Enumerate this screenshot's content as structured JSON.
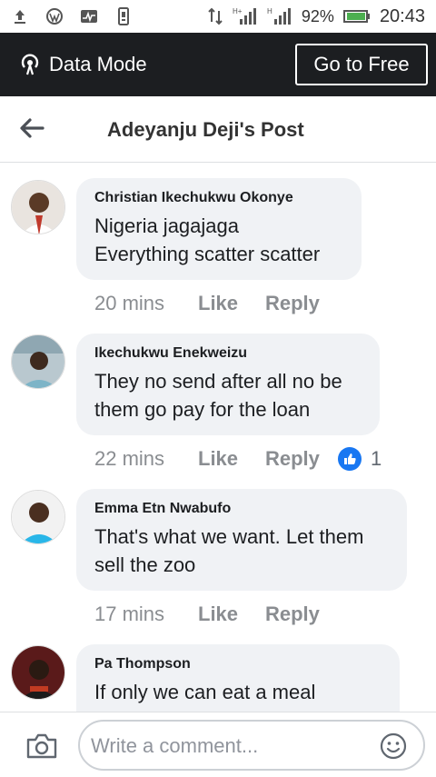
{
  "status_bar": {
    "battery": "92%",
    "time": "20:43",
    "icons": [
      "upload-icon",
      "wordpress-icon",
      "activity-icon",
      "phone-icon",
      "data-arrows-icon",
      "signal-h-icon",
      "signal-h-icon",
      "battery-icon"
    ]
  },
  "data_mode": {
    "label": "Data Mode",
    "button": "Go to Free"
  },
  "header": {
    "title": "Adeyanju Deji's Post"
  },
  "comments": [
    {
      "name": "Christian Ikechukwu Okonye",
      "lines": [
        "Nigeria jagajaga",
        "Everything scatter scatter"
      ],
      "time": "20 mins",
      "like": "Like",
      "reply": "Reply",
      "reactions": ""
    },
    {
      "name": "Ikechukwu Enekweizu",
      "lines": [
        "They no send after all no be",
        "them go pay for the loan"
      ],
      "time": "22 mins",
      "like": "Like",
      "reply": "Reply",
      "reactions": "1"
    },
    {
      "name": "Emma Etn Nwabufo",
      "lines": [
        "That's what we want. Let them",
        "sell the zoo"
      ],
      "time": "17 mins",
      "like": "Like",
      "reply": "Reply",
      "reactions": ""
    },
    {
      "name": "Pa Thompson",
      "lines": [
        "If only we can eat a meal"
      ],
      "time": "",
      "like": "",
      "reply": "",
      "reactions": ""
    }
  ],
  "composer": {
    "placeholder": "Write a comment..."
  },
  "colors": {
    "datamode_bg": "#1c1e21",
    "bubble_bg": "#f0f2f5",
    "like_blue": "#1877f2",
    "meta_gray": "#8a8d91"
  }
}
